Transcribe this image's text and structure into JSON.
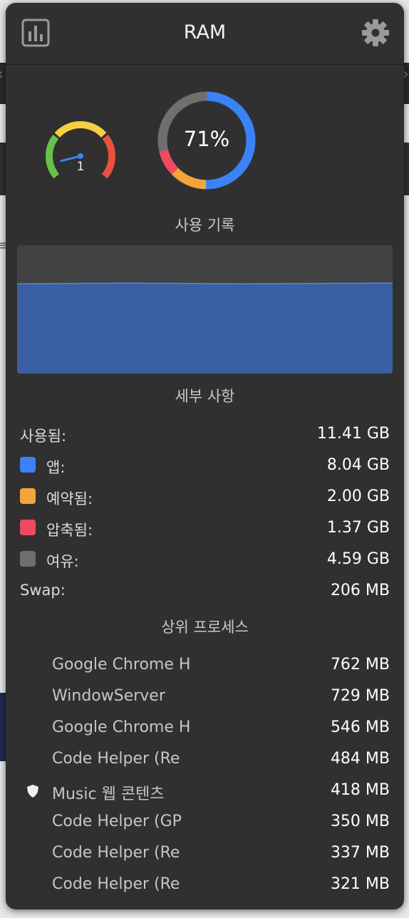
{
  "header": {
    "title": "RAM",
    "left_icon": "chart-icon",
    "right_icon": "gear-icon"
  },
  "gauge": {
    "value": "1",
    "level": 0.1,
    "colors": [
      "#67c04b",
      "#f5d03f",
      "#e9503d"
    ]
  },
  "donut": {
    "percent_label": "71%",
    "segments": [
      {
        "name": "app",
        "value": 8.04,
        "color": "#3b82f6"
      },
      {
        "name": "wired",
        "value": 2.0,
        "color": "#f4a43a"
      },
      {
        "name": "compressed",
        "value": 1.37,
        "color": "#ef4a5f"
      },
      {
        "name": "free",
        "value": 4.59,
        "color": "#6f6f6f"
      }
    ]
  },
  "history": {
    "title": "사용 기록",
    "fill_color": "#3a5fa2",
    "background_color": "#424242",
    "usage_level": 0.71
  },
  "details": {
    "title": "세부 사항",
    "used": {
      "label": "사용됨:",
      "value": "11.41 GB"
    },
    "app": {
      "label": "앱:",
      "value": "8.04 GB",
      "color": "#3b82f6"
    },
    "wired": {
      "label": "예약됨:",
      "value": "2.00 GB",
      "color": "#f4a43a"
    },
    "compressed": {
      "label": "압축됨:",
      "value": "1.37 GB",
      "color": "#ef4a5f"
    },
    "free": {
      "label": "여유:",
      "value": "4.59 GB",
      "color": "#6f6f6f"
    },
    "swap": {
      "label": "Swap:",
      "value": "206 MB"
    }
  },
  "processes": {
    "title": "상위 프로세스",
    "items": [
      {
        "name": "Google Chrome H",
        "value": "762 MB",
        "icon": ""
      },
      {
        "name": "WindowServer",
        "value": "729 MB",
        "icon": ""
      },
      {
        "name": "Google Chrome H",
        "value": "546 MB",
        "icon": ""
      },
      {
        "name": "Code Helper (Re",
        "value": "484 MB",
        "icon": ""
      },
      {
        "name": "Music 웹 콘텐츠",
        "value": "418 MB",
        "icon": "shield-icon"
      },
      {
        "name": "Code Helper (GP",
        "value": "350 MB",
        "icon": ""
      },
      {
        "name": "Code Helper (Re",
        "value": "337 MB",
        "icon": ""
      },
      {
        "name": "Code Helper (Re",
        "value": "321 MB",
        "icon": ""
      }
    ]
  }
}
